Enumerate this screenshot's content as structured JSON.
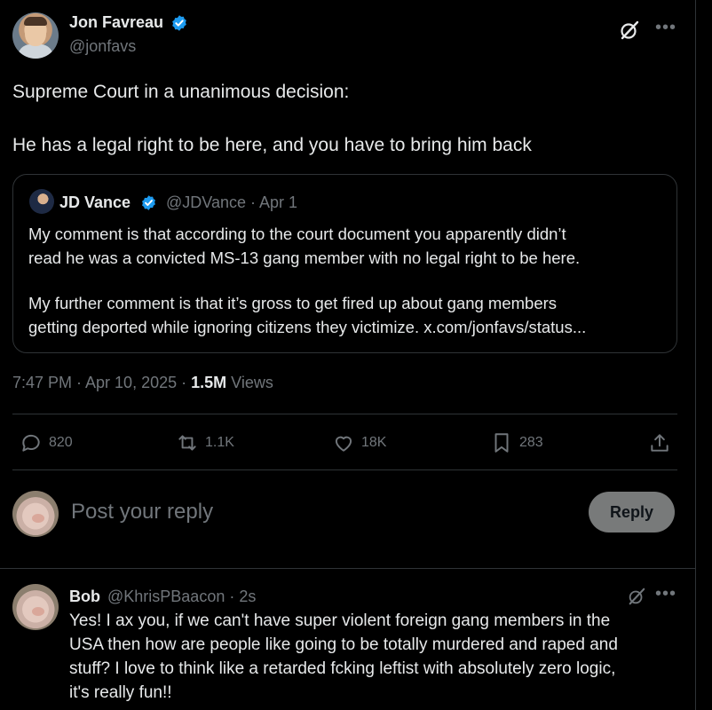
{
  "main_tweet": {
    "author_name": "Jon Favreau",
    "author_handle": "@jonfavs",
    "text_lines": [
      "Supreme Court in a unanimous decision:",
      "He has a legal right to be here, and you have to bring him back"
    ],
    "timestamp": "7:47 PM · Apr 10, 2025 · ",
    "views_count": "1.5M",
    "views_label": " Views"
  },
  "quoted_tweet": {
    "author_name": "JD Vance",
    "author_handle": "@JDVance",
    "date": "· Apr 1",
    "text_lines": [
      "My comment is that according to the court document you apparently didn’t",
      "read he was a convicted MS-13 gang member with no legal right to be here.",
      "My further comment is that it’s gross to get fired up about gang members",
      "getting deported while ignoring citizens they victimize. x.com/jonfavs/status..."
    ]
  },
  "actions": {
    "replies": "820",
    "reposts": "1.1K",
    "likes": "18K",
    "bookmarks": "283"
  },
  "composer": {
    "placeholder": "Post your reply",
    "reply_button": "Reply"
  },
  "reply_tweet": {
    "author_name": "Bob",
    "author_handle": "@KhrisPBaacon · 2s",
    "text_lines": [
      "Yes! I ax you, if we can't have super violent foreign gang members in the",
      "USA then how are people like going to be totally murdered and raped and",
      "stuff? I love to think like a retarded fcking leftist with absolutely zero logic,",
      "it's really fun!!"
    ]
  },
  "colors": {
    "background": "#000000",
    "text_primary": "#e7e9ea",
    "text_secondary": "#71767b",
    "verified_blue": "#1d9bf0",
    "border": "#2f3336",
    "reply_button_bg": "#787a7a"
  }
}
